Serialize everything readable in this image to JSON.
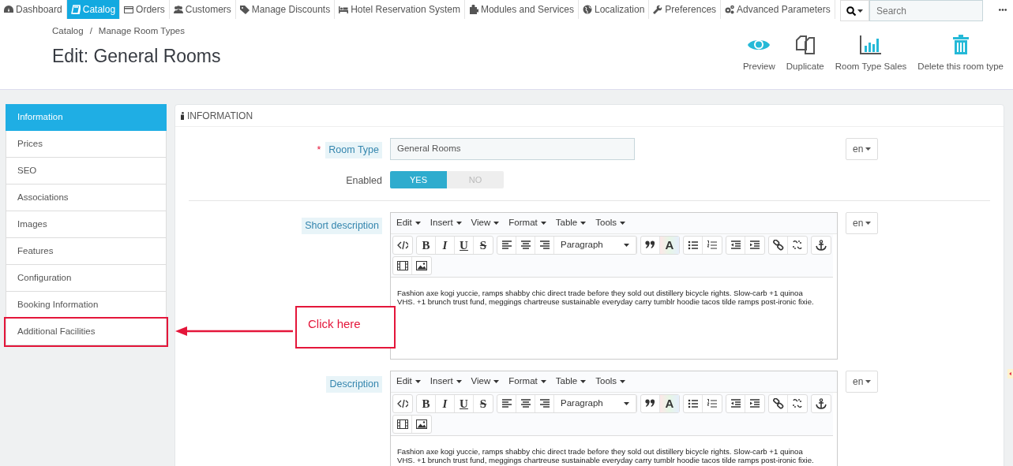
{
  "top_nav": {
    "items": [
      {
        "label": "Dashboard",
        "selected": false
      },
      {
        "label": "Catalog",
        "selected": true
      },
      {
        "label": "Orders",
        "selected": false
      },
      {
        "label": "Customers",
        "selected": false
      },
      {
        "label": "Manage Discounts",
        "selected": false
      },
      {
        "label": "Hotel Reservation System",
        "selected": false
      },
      {
        "label": "Modules and Services",
        "selected": false
      },
      {
        "label": "Localization",
        "selected": false
      },
      {
        "label": "Preferences",
        "selected": false
      },
      {
        "label": "Advanced Parameters",
        "selected": false
      }
    ],
    "search": {
      "placeholder": "Search"
    }
  },
  "breadcrumb": {
    "items": [
      "Catalog",
      "Manage Room Types"
    ],
    "separator": "/"
  },
  "page_title": "Edit: General Rooms",
  "actions": [
    {
      "label": "Preview"
    },
    {
      "label": "Duplicate"
    },
    {
      "label": "Room Type Sales"
    },
    {
      "label": "Delete this room type"
    }
  ],
  "sidebar": {
    "items": [
      {
        "label": "Information",
        "selected": true,
        "highlighted": false
      },
      {
        "label": "Prices",
        "selected": false,
        "highlighted": false
      },
      {
        "label": "SEO",
        "selected": false,
        "highlighted": false
      },
      {
        "label": "Associations",
        "selected": false,
        "highlighted": false
      },
      {
        "label": "Images",
        "selected": false,
        "highlighted": false
      },
      {
        "label": "Features",
        "selected": false,
        "highlighted": false
      },
      {
        "label": "Configuration",
        "selected": false,
        "highlighted": false
      },
      {
        "label": "Booking Information",
        "selected": false,
        "highlighted": false
      },
      {
        "label": "Additional Facilities",
        "selected": false,
        "highlighted": true
      }
    ]
  },
  "panel": {
    "title": "INFORMATION",
    "fields": [
      {
        "kind": "text",
        "label": "Room Type",
        "required_mark": "*",
        "value": "General Rooms",
        "language": "en"
      },
      {
        "kind": "switch",
        "label": "Enabled",
        "options": [
          "YES",
          "NO"
        ],
        "on": true
      },
      {
        "kind": "divider"
      },
      {
        "kind": "editor",
        "label": "Short description",
        "menus": [
          "Edit",
          "Insert",
          "View",
          "Format",
          "Table",
          "Tools"
        ],
        "letters": [
          "B",
          "I",
          "U",
          "S",
          "A"
        ],
        "format": "Paragraph",
        "content": "Fashion axe kogi yuccie, ramps shabby chic direct trade before they sold out distillery bicycle rights. Slow-carb +1 quinoa VHS. +1 brunch trust fund, meggings chartreuse sustainable everyday carry tumblr hoodie tacos tilde ramps post-ironic fixie.",
        "language": "en"
      },
      {
        "kind": "editor",
        "label": "Description",
        "menus": [
          "Edit",
          "Insert",
          "View",
          "Format",
          "Table",
          "Tools"
        ],
        "letters": [
          "B",
          "I",
          "U",
          "S",
          "A"
        ],
        "format": "Paragraph",
        "content": "Fashion axe kogi yuccie, ramps shabby chic direct trade before they sold out distillery bicycle rights. Slow-carb +1 quinoa VHS. +1 brunch trust fund, meggings chartreuse sustainable everyday carry tumblr hoodie tacos tilde ramps post-ironic fixie.",
        "language": "en"
      }
    ]
  },
  "annotation": {
    "text": "Click here"
  }
}
